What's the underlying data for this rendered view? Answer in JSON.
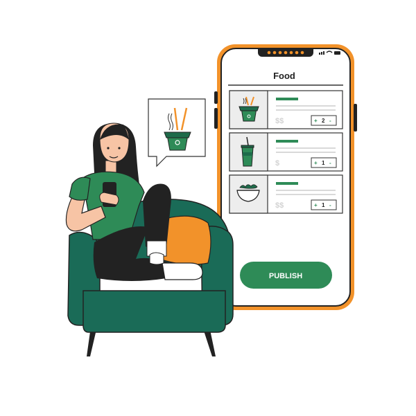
{
  "colors": {
    "orange": "#F2922A",
    "green": "#2E8B57",
    "dark_green": "#1E6B4A",
    "chair": "#1A6B57",
    "ink": "#222222",
    "light_gray": "#D9D9D9"
  },
  "phone": {
    "header_title": "Food",
    "publish_label": "PUBLISH",
    "items": [
      {
        "icon": "noodle-box-icon",
        "price": "$$",
        "quantity": "2"
      },
      {
        "icon": "drink-cup-icon",
        "price": "$",
        "quantity": "1"
      },
      {
        "icon": "salad-bowl-icon",
        "price": "$$",
        "quantity": "1"
      }
    ],
    "stepper": {
      "plus": "+",
      "minus": "-"
    }
  },
  "speech_bubble": {
    "icon": "noodle-box-icon"
  }
}
